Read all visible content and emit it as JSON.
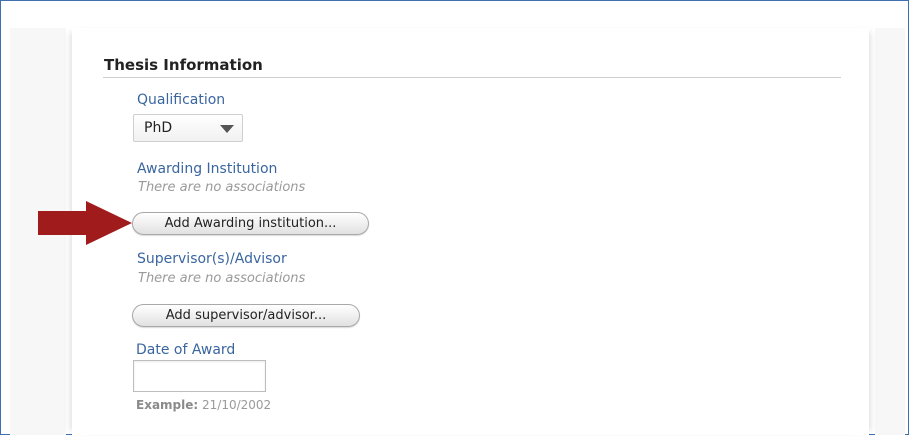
{
  "section": {
    "title": "Thesis Information"
  },
  "qualification": {
    "label": "Qualification",
    "selected": "PhD"
  },
  "awarding_institution": {
    "label": "Awarding Institution",
    "empty_text": "There are no associations",
    "add_button": "Add Awarding institution..."
  },
  "supervisor": {
    "label": "Supervisor(s)/Advisor",
    "empty_text": "There are no associations",
    "add_button": "Add supervisor/advisor..."
  },
  "date_of_award": {
    "label": "Date of Award",
    "value": "",
    "example_label": "Example:",
    "example_value": "21/10/2002"
  },
  "colors": {
    "label_blue": "#3a66a0",
    "arrow_red": "#a01c1c",
    "frame_border": "#3f6fae"
  },
  "icons": {
    "arrow": "red-right-arrow-icon",
    "dropdown": "chevron-down-icon"
  }
}
